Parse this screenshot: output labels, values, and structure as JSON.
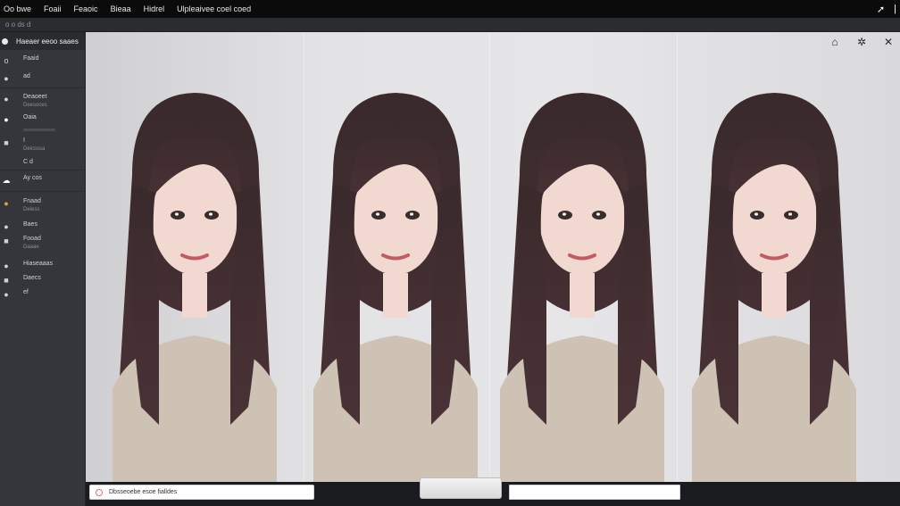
{
  "menubar": {
    "items": [
      "Oo bwe",
      "Foaii",
      "Feaoic",
      "Bieaa",
      "Hidrel",
      "Ulpleaivee coel coed"
    ],
    "right_icons": [
      "arrow-icon",
      "divider-icon"
    ]
  },
  "subbar": {
    "crumb": "o  o ds d"
  },
  "sidebar": {
    "header_label": "Haeaer eeoo saaes",
    "rows": [
      {
        "icon": "o",
        "label": "Faaid",
        "sub": ""
      },
      {
        "icon": "●",
        "label": "ad",
        "sub": ""
      },
      {
        "icon": "●",
        "label": "Deaoeet",
        "sub": "Deesoces"
      },
      {
        "icon": "●",
        "label": "Oaia",
        "sub": ""
      },
      {
        "icon": "■",
        "label": "I",
        "sub": "Deicsssa"
      },
      {
        "icon": "",
        "label": "C   d",
        "sub": ""
      },
      {
        "icon": "☁",
        "label": "Ay  cos",
        "sub": ""
      },
      {
        "icon": "●",
        "label": "Fnaad",
        "sub": "Deiess"
      },
      {
        "icon": "●",
        "label": "Baes",
        "sub": ""
      },
      {
        "icon": "■",
        "label": "Fooad",
        "sub": "Daaae"
      },
      {
        "icon": "●",
        "label": "Hiaseaaas",
        "sub": ""
      },
      {
        "icon": "■",
        "label": "Daecs",
        "sub": ""
      },
      {
        "icon": "●",
        "label": "ef",
        "sub": ""
      }
    ]
  },
  "viewport": {
    "top_icons": [
      "home-icon",
      "settings-icon",
      "close-icon"
    ],
    "colors": {
      "hair": "#3a2a2c",
      "skin": "#f1d9d2",
      "sweater": "#cdc2b3",
      "background": "#e3e3e6"
    }
  },
  "bottombar": {
    "prompt_text": "Dbsseoebe esoe fialldes",
    "second_value": ""
  }
}
